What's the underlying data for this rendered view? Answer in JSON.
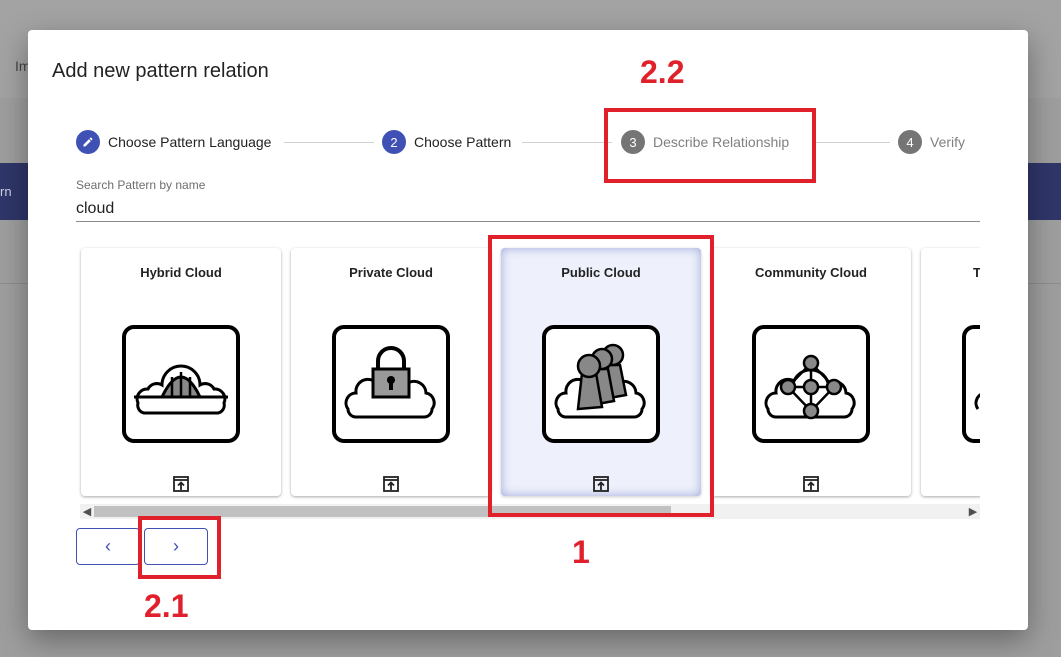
{
  "background": {
    "topbar_text": "Im",
    "bluebar_text": "rn"
  },
  "dialog": {
    "title": "Add new pattern relation"
  },
  "stepper": {
    "steps": [
      {
        "number": "",
        "label": "Choose Pattern Language",
        "state": "completed",
        "icon": "pencil-icon"
      },
      {
        "number": "2",
        "label": "Choose Pattern",
        "state": "active"
      },
      {
        "number": "3",
        "label": "Describe Relationship",
        "state": "inactive"
      },
      {
        "number": "4",
        "label": "Verify",
        "state": "inactive"
      }
    ]
  },
  "search": {
    "label": "Search Pattern by name",
    "value": "cloud"
  },
  "cards": [
    {
      "title": "Hybrid Cloud",
      "icon": "hybrid-cloud-icon",
      "selected": false
    },
    {
      "title": "Private Cloud",
      "icon": "private-cloud-icon",
      "selected": false
    },
    {
      "title": "Public Cloud",
      "icon": "public-cloud-icon",
      "selected": true
    },
    {
      "title": "Community Cloud",
      "icon": "community-cloud-icon",
      "selected": false
    },
    {
      "title": "T",
      "icon": "partial-cloud-icon",
      "selected": false
    }
  ],
  "nav": {
    "prev_symbol": "‹",
    "next_symbol": "›"
  },
  "annotations": {
    "label_1": "1",
    "label_2_1": "2.1",
    "label_2_2": "2.2"
  },
  "colors": {
    "accent": "#3f51b5",
    "annotation_red": "#e0202a",
    "inactive_step": "#757575"
  }
}
